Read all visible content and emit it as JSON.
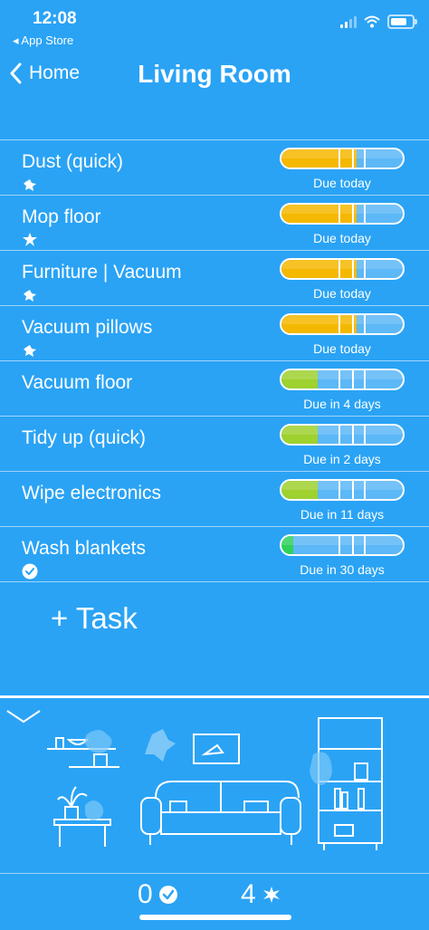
{
  "status_bar": {
    "time": "12:08",
    "back_app": "◂ App Store"
  },
  "nav": {
    "back_label": "Home",
    "title": "Living Room"
  },
  "tasks": [
    {
      "name": "Dust (quick)",
      "due": "Due today",
      "level": 0.62,
      "color": "#f5b800",
      "icon": "spark-icon"
    },
    {
      "name": "Mop floor",
      "due": "Due today",
      "level": 0.62,
      "color": "#f5b800",
      "icon": "star-icon"
    },
    {
      "name": "Furniture | Vacuum",
      "due": "Due today",
      "level": 0.62,
      "color": "#f5b800",
      "icon": "spark-icon"
    },
    {
      "name": "Vacuum pillows",
      "due": "Due today",
      "level": 0.62,
      "color": "#f5b800",
      "icon": "spark-icon"
    },
    {
      "name": "Vacuum floor",
      "due": "Due in 4 days",
      "level": 0.3,
      "color": "#9fd12f",
      "icon": ""
    },
    {
      "name": "Tidy up (quick)",
      "due": "Due in 2 days",
      "level": 0.3,
      "color": "#9fd12f",
      "icon": ""
    },
    {
      "name": "Wipe electronics",
      "due": "Due in 11 days",
      "level": 0.3,
      "color": "#9fd12f",
      "icon": ""
    },
    {
      "name": "Wash blankets",
      "due": "Due in 30 days",
      "level": 0.1,
      "color": "#2fd15a",
      "icon": "check-circle-icon"
    }
  ],
  "add_task_label": "+ Task",
  "footer": {
    "done_count": "0",
    "dirty_count": "4"
  },
  "colors": {
    "background": "#2aa3f5",
    "meter_track": "#5cb8f7"
  }
}
